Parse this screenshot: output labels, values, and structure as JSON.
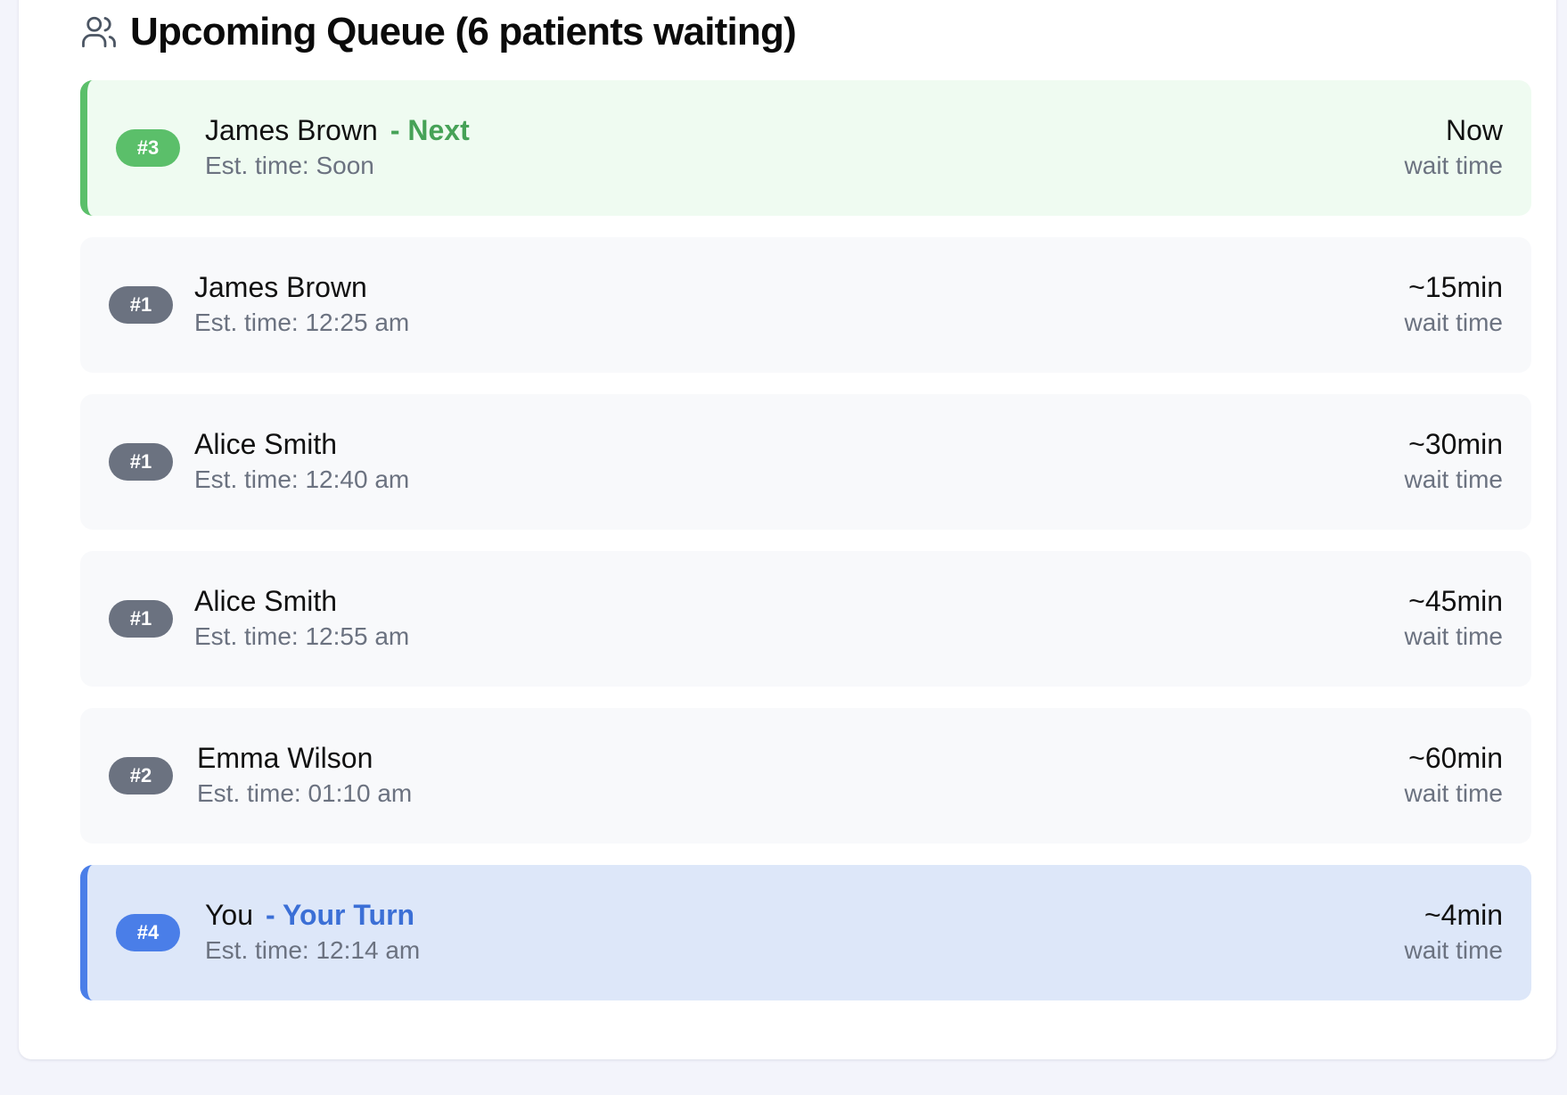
{
  "header": {
    "icon": "users-icon",
    "title": "Upcoming Queue (6 patients waiting)"
  },
  "colors": {
    "next_accent": "#5bbf6a",
    "you_accent": "#4a7ee8",
    "default_badge": "#6b7280"
  },
  "queue": [
    {
      "badge": "#3",
      "name": "James Brown",
      "tag": "- Next",
      "est": "Est. time: Soon",
      "wait_value": "Now",
      "wait_label": "wait time"
    },
    {
      "badge": "#1",
      "name": "James Brown",
      "tag": "",
      "est": "Est. time: 12:25 am",
      "wait_value": "~15min",
      "wait_label": "wait time"
    },
    {
      "badge": "#1",
      "name": "Alice Smith",
      "tag": "",
      "est": "Est. time: 12:40 am",
      "wait_value": "~30min",
      "wait_label": "wait time"
    },
    {
      "badge": "#1",
      "name": "Alice Smith",
      "tag": "",
      "est": "Est. time: 12:55 am",
      "wait_value": "~45min",
      "wait_label": "wait time"
    },
    {
      "badge": "#2",
      "name": "Emma Wilson",
      "tag": "",
      "est": "Est. time: 01:10 am",
      "wait_value": "~60min",
      "wait_label": "wait time"
    },
    {
      "badge": "#4",
      "name": "You",
      "tag": "- Your Turn",
      "est": "Est. time: 12:14 am",
      "wait_value": "~4min",
      "wait_label": "wait time"
    }
  ]
}
